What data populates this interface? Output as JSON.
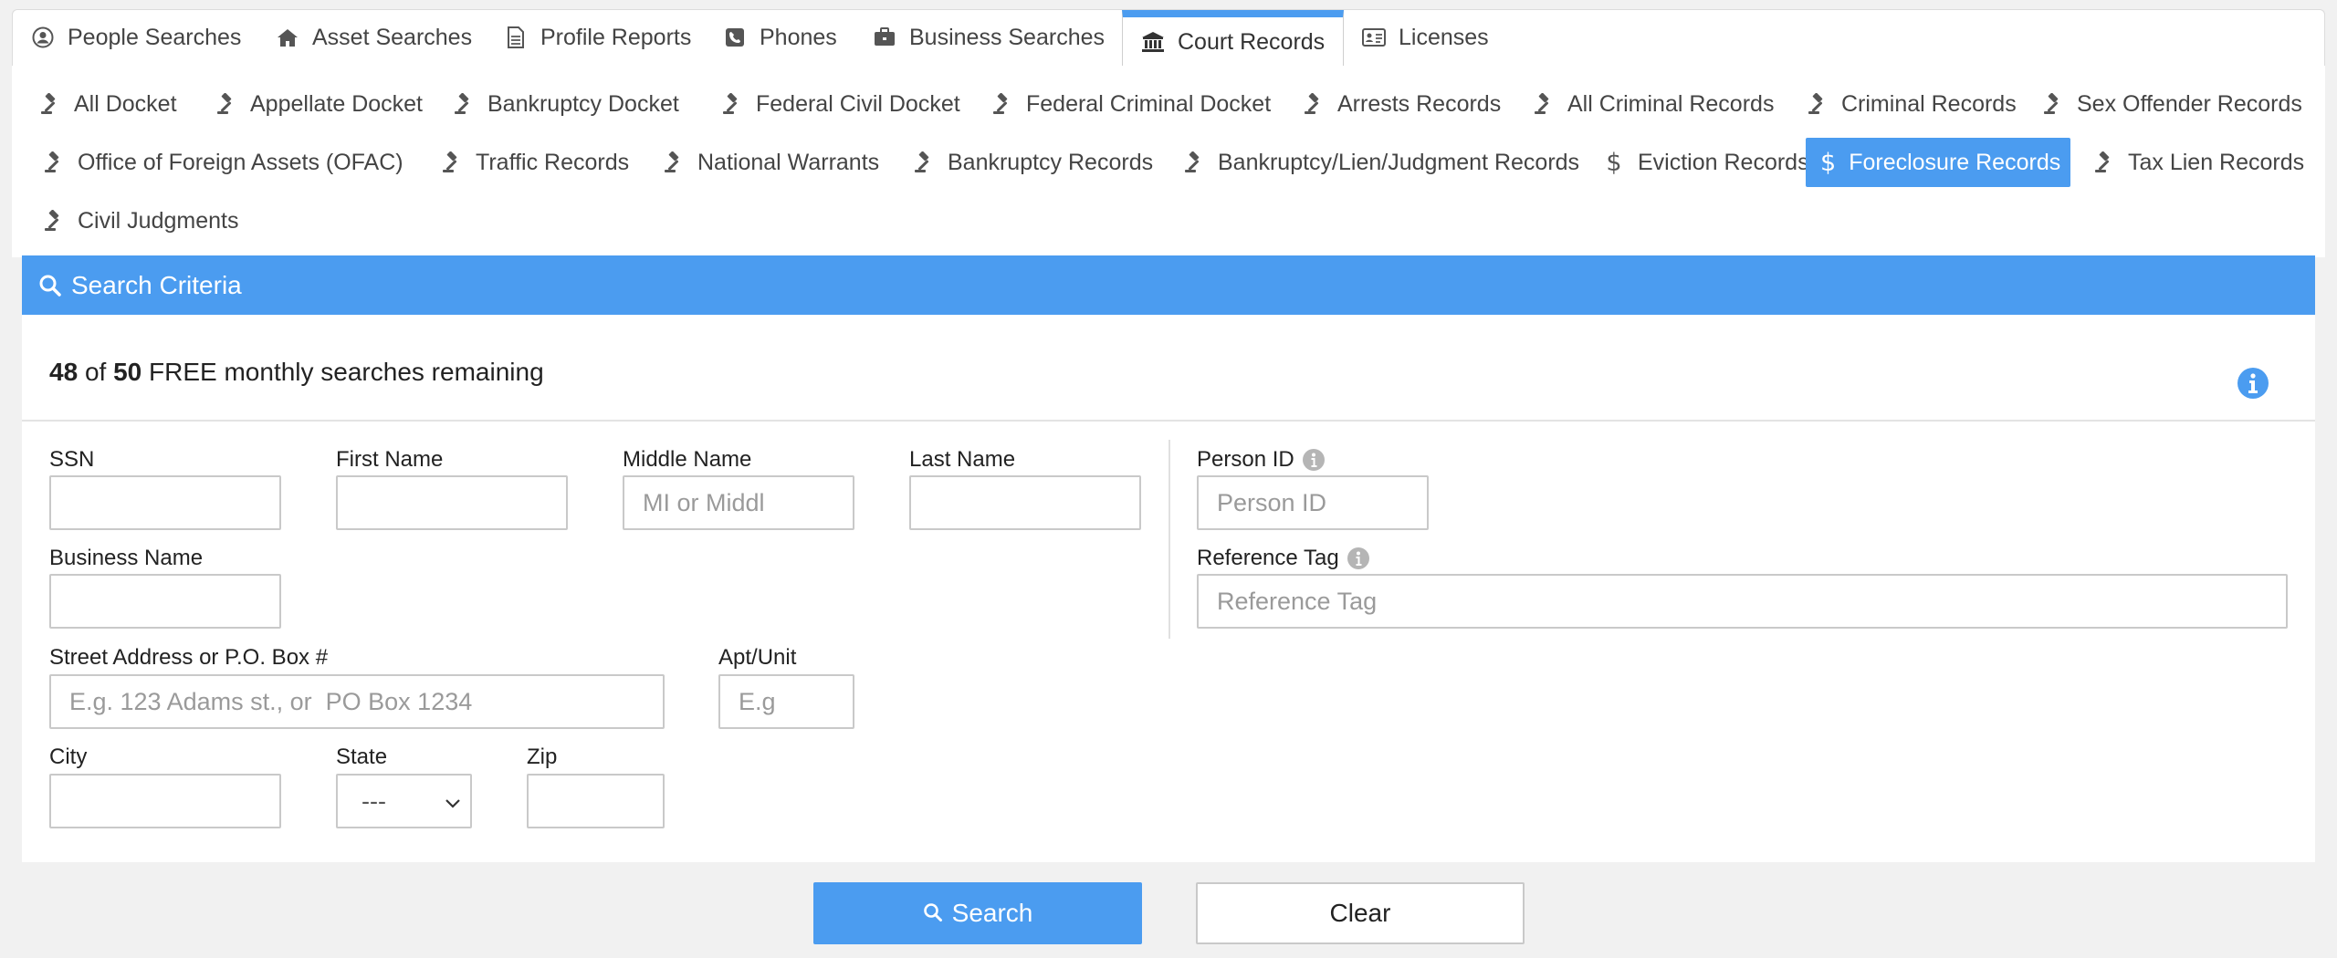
{
  "top_tabs": [
    {
      "label": "People Searches",
      "icon": "user-circle-icon"
    },
    {
      "label": "Asset Searches",
      "icon": "home-icon"
    },
    {
      "label": "Profile Reports",
      "icon": "document-icon"
    },
    {
      "label": "Phones",
      "icon": "phone-icon"
    },
    {
      "label": "Business Searches",
      "icon": "briefcase-icon"
    },
    {
      "label": "Court Records",
      "icon": "courthouse-icon",
      "active": true
    },
    {
      "label": "Licenses",
      "icon": "id-card-icon"
    }
  ],
  "sub_tabs": [
    {
      "label": "All Docket",
      "icon": "gavel-icon"
    },
    {
      "label": "Appellate Docket",
      "icon": "gavel-icon"
    },
    {
      "label": "Bankruptcy Docket",
      "icon": "gavel-icon"
    },
    {
      "label": "Federal Civil Docket",
      "icon": "gavel-icon"
    },
    {
      "label": "Federal Criminal Docket",
      "icon": "gavel-icon"
    },
    {
      "label": "Arrests Records",
      "icon": "gavel-icon"
    },
    {
      "label": "All Criminal Records",
      "icon": "gavel-icon"
    },
    {
      "label": "Criminal Records",
      "icon": "gavel-icon"
    },
    {
      "label": "Sex Offender Records",
      "icon": "gavel-icon"
    },
    {
      "label": "Office of Foreign Assets (OFAC)",
      "icon": "gavel-icon"
    },
    {
      "label": "Traffic Records",
      "icon": "gavel-icon"
    },
    {
      "label": "National Warrants",
      "icon": "gavel-icon"
    },
    {
      "label": "Bankruptcy Records",
      "icon": "gavel-icon"
    },
    {
      "label": "Bankruptcy/Lien/Judgment Records",
      "icon": "gavel-icon"
    },
    {
      "label": "Eviction Records",
      "icon": "dollar-icon"
    },
    {
      "label": "Foreclosure Records",
      "icon": "dollar-icon",
      "active": true
    },
    {
      "label": "Tax Lien Records",
      "icon": "gavel-icon"
    },
    {
      "label": "Civil Judgments",
      "icon": "gavel-icon"
    }
  ],
  "criteria": {
    "title": "Search Criteria"
  },
  "remaining": {
    "used": "48",
    "of": "of",
    "total": "50",
    "text": "FREE monthly searches remaining"
  },
  "form": {
    "ssn": {
      "label": "SSN",
      "value": "",
      "placeholder": ""
    },
    "first_name": {
      "label": "First Name",
      "value": "",
      "placeholder": ""
    },
    "middle_name": {
      "label": "Middle Name",
      "value": "",
      "placeholder": "MI or Middl"
    },
    "last_name": {
      "label": "Last Name",
      "value": "",
      "placeholder": ""
    },
    "person_id": {
      "label": "Person ID",
      "value": "",
      "placeholder": "Person ID"
    },
    "business_name": {
      "label": "Business Name",
      "value": "",
      "placeholder": ""
    },
    "reference_tag": {
      "label": "Reference Tag",
      "value": "",
      "placeholder": "Reference Tag"
    },
    "street": {
      "label": "Street Address or P.O. Box #",
      "value": "",
      "placeholder": "E.g. 123 Adams st., or  PO Box 1234"
    },
    "apt": {
      "label": "Apt/Unit",
      "value": "",
      "placeholder": "E.g"
    },
    "city": {
      "label": "City",
      "value": "",
      "placeholder": ""
    },
    "state": {
      "label": "State",
      "value": "---"
    },
    "zip": {
      "label": "Zip",
      "value": "",
      "placeholder": ""
    }
  },
  "buttons": {
    "search": "Search",
    "clear": "Clear"
  },
  "colors": {
    "accent": "#4b9cf0",
    "panel": "#ffffff",
    "background": "#f1f1f1"
  }
}
